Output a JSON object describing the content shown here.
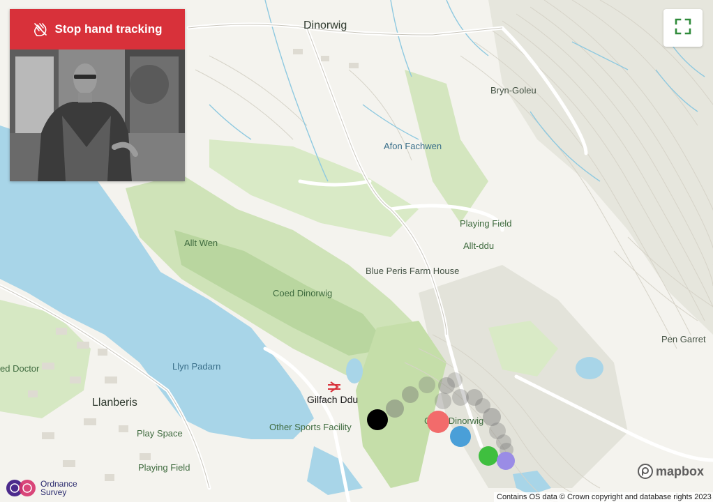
{
  "controls": {
    "stop_tracking_label": "Stop hand tracking",
    "fullscreen_icon": "fullscreen-icon",
    "hand_icon": "hand-stop-icon"
  },
  "map": {
    "places": [
      {
        "id": "dinorwig",
        "label": "Dinorwig"
      },
      {
        "id": "bryn-goleu",
        "label": "Bryn-Goleu"
      },
      {
        "id": "afon-fachwen",
        "label": "Afon Fachwen"
      },
      {
        "id": "playing-field-1",
        "label": "Playing Field"
      },
      {
        "id": "allt-ddu",
        "label": "Allt-ddu"
      },
      {
        "id": "allt-wen",
        "label": "Allt Wen"
      },
      {
        "id": "blue-peris",
        "label": "Blue Peris Farm House"
      },
      {
        "id": "coed-dinorwig-1",
        "label": "Coed Dinorwig"
      },
      {
        "id": "pen-garret",
        "label": "Pen Garret"
      },
      {
        "id": "ed-doctor",
        "label": "ed Doctor"
      },
      {
        "id": "llyn-padarn",
        "label": "Llyn Padarn"
      },
      {
        "id": "llanberis",
        "label": "Llanberis"
      },
      {
        "id": "gilfach-ddu",
        "label": "Gilfach Ddu"
      },
      {
        "id": "other-sports",
        "label": "Other Sports Facility"
      },
      {
        "id": "coed-dinorwig-2",
        "label": "Coed Dinorwig"
      },
      {
        "id": "play-space",
        "label": "Play Space"
      },
      {
        "id": "playing-field-2",
        "label": "Playing Field"
      }
    ],
    "colors": {
      "water": "#a8d5e8",
      "land": "#f4f3ee",
      "woodland": "#cfe3b8",
      "woodland_dark": "#b5d39a",
      "contour": "#d6d3c8",
      "stream": "#8ec9e0",
      "road": "#ffffff",
      "rail_icon": "#d8313a"
    },
    "tracking_markers": [
      {
        "color": "#000000"
      },
      {
        "color": "#f26b6b"
      },
      {
        "color": "#4a9fd8"
      },
      {
        "color": "#3fbf3f"
      },
      {
        "color": "#9a8ce6"
      }
    ]
  },
  "branding": {
    "mapbox": "mapbox",
    "os_line1": "Ordnance",
    "os_line2": "Survey"
  },
  "attribution": "Contains OS data © Crown copyright and database rights 2023"
}
